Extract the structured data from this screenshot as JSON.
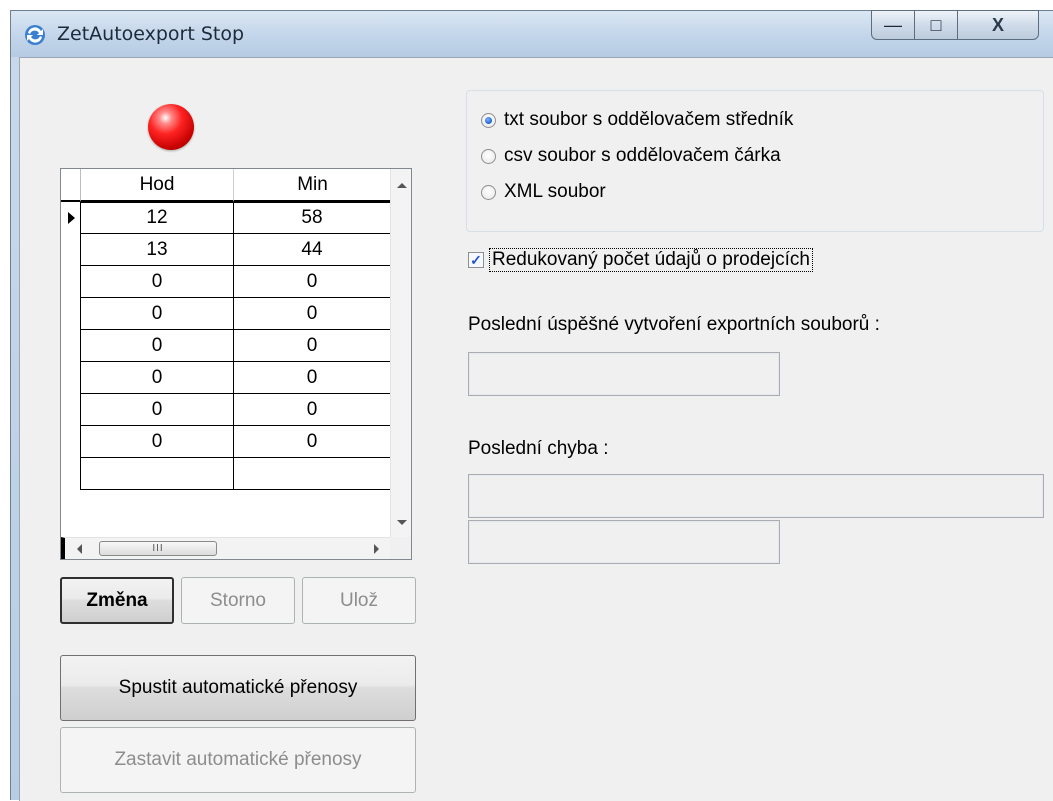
{
  "window": {
    "title": "ZetAutoexport Stop",
    "controls": {
      "minimize": "—",
      "maximize": "□",
      "close": "X"
    }
  },
  "status": {
    "light_color": "#e00000",
    "state": "stopped"
  },
  "schedule_grid": {
    "columns": [
      "Hod",
      "Min"
    ],
    "rows": [
      {
        "hod": "12",
        "min": "58"
      },
      {
        "hod": "13",
        "min": "44"
      },
      {
        "hod": "0",
        "min": "0"
      },
      {
        "hod": "0",
        "min": "0"
      },
      {
        "hod": "0",
        "min": "0"
      },
      {
        "hod": "0",
        "min": "0"
      },
      {
        "hod": "0",
        "min": "0"
      },
      {
        "hod": "0",
        "min": "0"
      },
      {
        "hod": "",
        "min": ""
      }
    ],
    "current_row": 0,
    "scroll_thumb_text": "III"
  },
  "buttons": {
    "zmena": "Změna",
    "storno": "Storno",
    "uloz": "Ulož",
    "start": "Spustit automatické přenosy",
    "stop": "Zastavit automatické přenosy"
  },
  "format": {
    "options": [
      "txt soubor s oddělovačem středník",
      "csv soubor s oddělovačem čárka",
      "XML soubor"
    ],
    "selected": 0
  },
  "reduced": {
    "label": "Redukovaný počet údajů o prodejcích",
    "checked": true
  },
  "last_success": {
    "label": "Poslední úspěšné vytvoření exportních souborů :",
    "value": ""
  },
  "last_error": {
    "label": "Poslední chyba :",
    "value1": "",
    "value2": ""
  }
}
